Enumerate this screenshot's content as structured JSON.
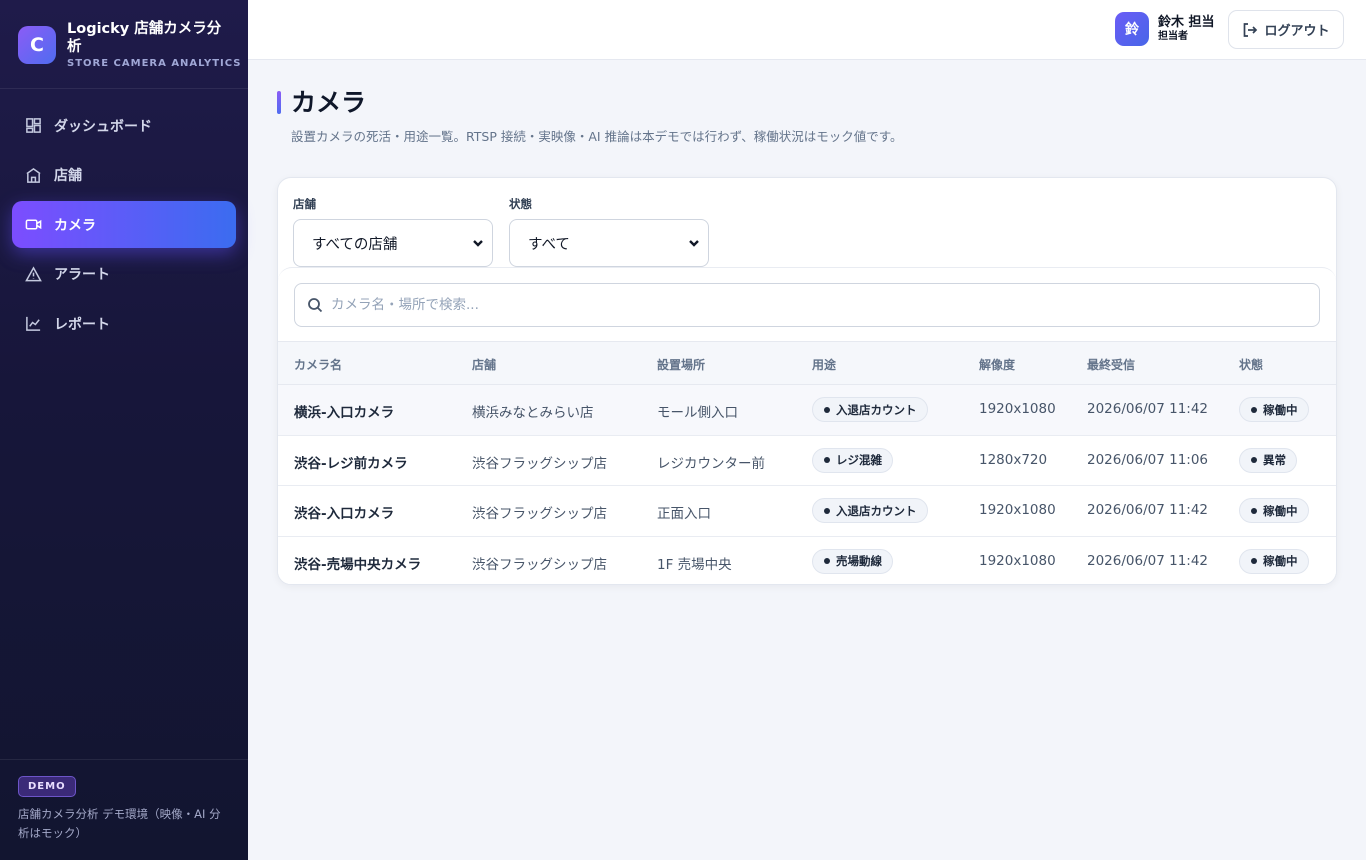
{
  "brand": {
    "logo_letter": "C",
    "title": "Logicky 店舗カメラ分析",
    "subtitle": "STORE CAMERA ANALYTICS"
  },
  "nav": [
    {
      "label": "ダッシュボード",
      "icon": "dashboard-icon",
      "active": false
    },
    {
      "label": "店舗",
      "icon": "store-icon",
      "active": false
    },
    {
      "label": "カメラ",
      "icon": "camera-icon",
      "active": true
    },
    {
      "label": "アラート",
      "icon": "alert-icon",
      "active": false
    },
    {
      "label": "レポート",
      "icon": "report-icon",
      "active": false
    }
  ],
  "footer": {
    "badge": "DEMO",
    "text": "店舗カメラ分析 デモ環境（映像・AI 分析はモック）"
  },
  "header": {
    "avatar_text": "鈴",
    "user_name": "鈴木 担当",
    "user_role": "担当者",
    "logout_label": "ログアウト"
  },
  "page": {
    "title": "カメラ",
    "description": "設置カメラの死活・用途一覧。RTSP 接続・実映像・AI 推論は本デモでは行わず、稼働状況はモック値です。"
  },
  "filters": {
    "store_label": "店舗",
    "store_value": "すべての店舗",
    "status_label": "状態",
    "status_value": "すべて"
  },
  "search": {
    "placeholder": "カメラ名・場所で検索..."
  },
  "table": {
    "headers": [
      "カメラ名",
      "店舗",
      "設置場所",
      "用途",
      "解像度",
      "最終受信",
      "状態"
    ],
    "rows": [
      {
        "name": "横浜-入口カメラ",
        "store": "横浜みなとみらい店",
        "location": "モール側入口",
        "purpose": "入退店カウント",
        "resolution": "1920x1080",
        "last": "2026/06/07 11:42",
        "status": "稼働中"
      },
      {
        "name": "渋谷-レジ前カメラ",
        "store": "渋谷フラッグシップ店",
        "location": "レジカウンター前",
        "purpose": "レジ混雑",
        "resolution": "1280x720",
        "last": "2026/06/07 11:06",
        "status": "異常"
      },
      {
        "name": "渋谷-入口カメラ",
        "store": "渋谷フラッグシップ店",
        "location": "正面入口",
        "purpose": "入退店カウント",
        "resolution": "1920x1080",
        "last": "2026/06/07 11:42",
        "status": "稼働中"
      },
      {
        "name": "渋谷-売場中央カメラ",
        "store": "渋谷フラッグシップ店",
        "location": "1F 売場中央",
        "purpose": "売場動線",
        "resolution": "1920x1080",
        "last": "2026/06/07 11:42",
        "status": "稼働中"
      }
    ]
  },
  "colors": {
    "accent_start": "#7c4dff",
    "accent_end": "#3b6cf0",
    "sidebar_bg": "#1f1b4a"
  }
}
